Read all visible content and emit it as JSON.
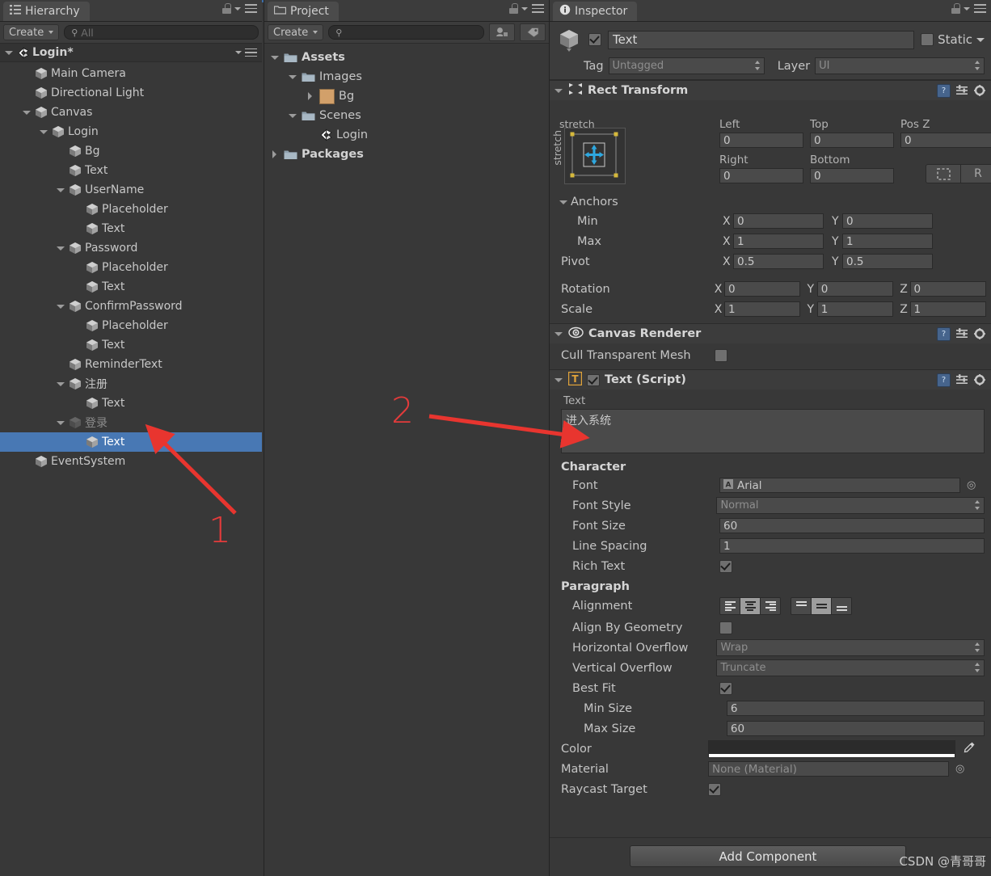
{
  "hierarchy": {
    "tab_label": "Hierarchy",
    "create_label": "Create",
    "search_placeholder": "All",
    "scene_name": "Login*",
    "items": [
      {
        "label": "Main Camera",
        "depth": 1,
        "twist": "none",
        "icon": "cube",
        "selected": false,
        "dim": false
      },
      {
        "label": "Directional Light",
        "depth": 1,
        "twist": "none",
        "icon": "cube",
        "selected": false,
        "dim": false
      },
      {
        "label": "Canvas",
        "depth": 1,
        "twist": "open",
        "icon": "cube",
        "selected": false,
        "dim": false
      },
      {
        "label": "Login",
        "depth": 2,
        "twist": "open",
        "icon": "cube",
        "selected": false,
        "dim": false
      },
      {
        "label": "Bg",
        "depth": 3,
        "twist": "none",
        "icon": "cube",
        "selected": false,
        "dim": false
      },
      {
        "label": "Text",
        "depth": 3,
        "twist": "none",
        "icon": "cube",
        "selected": false,
        "dim": false
      },
      {
        "label": "UserName",
        "depth": 3,
        "twist": "open",
        "icon": "cube",
        "selected": false,
        "dim": false
      },
      {
        "label": "Placeholder",
        "depth": 4,
        "twist": "none",
        "icon": "cube",
        "selected": false,
        "dim": false
      },
      {
        "label": "Text",
        "depth": 4,
        "twist": "none",
        "icon": "cube",
        "selected": false,
        "dim": false
      },
      {
        "label": "Password",
        "depth": 3,
        "twist": "open",
        "icon": "cube",
        "selected": false,
        "dim": false
      },
      {
        "label": "Placeholder",
        "depth": 4,
        "twist": "none",
        "icon": "cube",
        "selected": false,
        "dim": false
      },
      {
        "label": "Text",
        "depth": 4,
        "twist": "none",
        "icon": "cube",
        "selected": false,
        "dim": false
      },
      {
        "label": "ConfirmPassword",
        "depth": 3,
        "twist": "open",
        "icon": "cube",
        "selected": false,
        "dim": false
      },
      {
        "label": "Placeholder",
        "depth": 4,
        "twist": "none",
        "icon": "cube",
        "selected": false,
        "dim": false
      },
      {
        "label": "Text",
        "depth": 4,
        "twist": "none",
        "icon": "cube",
        "selected": false,
        "dim": false
      },
      {
        "label": "ReminderText",
        "depth": 3,
        "twist": "none",
        "icon": "cube",
        "selected": false,
        "dim": false
      },
      {
        "label": "注册",
        "depth": 3,
        "twist": "open",
        "icon": "cube",
        "selected": false,
        "dim": false
      },
      {
        "label": "Text",
        "depth": 4,
        "twist": "none",
        "icon": "cube",
        "selected": false,
        "dim": false
      },
      {
        "label": "登录",
        "depth": 3,
        "twist": "open",
        "icon": "cube",
        "selected": false,
        "dim": true
      },
      {
        "label": "Text",
        "depth": 4,
        "twist": "none",
        "icon": "cube",
        "selected": true,
        "dim": false
      },
      {
        "label": "EventSystem",
        "depth": 1,
        "twist": "none",
        "icon": "cube",
        "selected": false,
        "dim": false
      }
    ]
  },
  "project": {
    "tab_label": "Project",
    "create_label": "Create",
    "search_placeholder": "",
    "items": [
      {
        "label": "Assets",
        "depth": 0,
        "twist": "open",
        "icon": "folder",
        "bold": true
      },
      {
        "label": "Images",
        "depth": 1,
        "twist": "open",
        "icon": "folder",
        "bold": false
      },
      {
        "label": "Bg",
        "depth": 2,
        "twist": "closed",
        "icon": "texture",
        "bold": false
      },
      {
        "label": "Scenes",
        "depth": 1,
        "twist": "open",
        "icon": "folder",
        "bold": false
      },
      {
        "label": "Login",
        "depth": 2,
        "twist": "none",
        "icon": "unity",
        "bold": false
      },
      {
        "label": "Packages",
        "depth": 0,
        "twist": "closed",
        "icon": "folder",
        "bold": true
      }
    ]
  },
  "inspector": {
    "tab_label": "Inspector",
    "object_name": "Text",
    "object_enabled": true,
    "static_label": "Static",
    "static_checked": false,
    "tag_label": "Tag",
    "tag_value": "Untagged",
    "layer_label": "Layer",
    "layer_value": "UI",
    "rect_transform": {
      "title": "Rect Transform",
      "anchor_preset_top": "stretch",
      "anchor_preset_left": "stretch",
      "left_label": "Left",
      "left_value": "0",
      "top_label": "Top",
      "top_value": "0",
      "posz_label": "Pos Z",
      "posz_value": "0",
      "right_label": "Right",
      "right_value": "0",
      "bottom_label": "Bottom",
      "bottom_value": "0",
      "blueprint_button": "",
      "raw_button": "R",
      "anchors_label": "Anchors",
      "min_label": "Min",
      "min_x": "0",
      "min_y": "0",
      "max_label": "Max",
      "max_x": "1",
      "max_y": "1",
      "pivot_label": "Pivot",
      "pivot_x": "0.5",
      "pivot_y": "0.5",
      "rotation_label": "Rotation",
      "rot_x": "0",
      "rot_y": "0",
      "rot_z": "0",
      "scale_label": "Scale",
      "scale_x": "1",
      "scale_y": "1",
      "scale_z": "1",
      "axis_x": "X",
      "axis_y": "Y",
      "axis_z": "Z"
    },
    "canvas_renderer": {
      "title": "Canvas Renderer",
      "cull_label": "Cull Transparent Mesh",
      "cull_checked": false
    },
    "text_script": {
      "title": "Text (Script)",
      "enabled": true,
      "text_label": "Text",
      "text_value": "进入系统",
      "character_label": "Character",
      "font_label": "Font",
      "font_value": "Arial",
      "font_style_label": "Font Style",
      "font_style_value": "Normal",
      "font_size_label": "Font Size",
      "font_size_value": "60",
      "line_spacing_label": "Line Spacing",
      "line_spacing_value": "1",
      "rich_text_label": "Rich Text",
      "rich_text_checked": true,
      "paragraph_label": "Paragraph",
      "alignment_label": "Alignment",
      "alignment_h_selected": 1,
      "alignment_v_selected": 1,
      "align_geometry_label": "Align By Geometry",
      "align_geometry_checked": false,
      "h_overflow_label": "Horizontal Overflow",
      "h_overflow_value": "Wrap",
      "v_overflow_label": "Vertical Overflow",
      "v_overflow_value": "Truncate",
      "best_fit_label": "Best Fit",
      "best_fit_checked": true,
      "min_size_label": "Min Size",
      "min_size_value": "6",
      "max_size_label": "Max Size",
      "max_size_value": "60",
      "color_label": "Color",
      "color_value": "#2b2b2b",
      "material_label": "Material",
      "material_value": "None (Material)",
      "raycast_label": "Raycast Target",
      "raycast_checked": true
    },
    "add_component_label": "Add Component"
  },
  "annotations": {
    "marker_one": "1",
    "marker_two": "2",
    "color": "#e33b3b"
  },
  "watermark": "CSDN @青哥哥"
}
